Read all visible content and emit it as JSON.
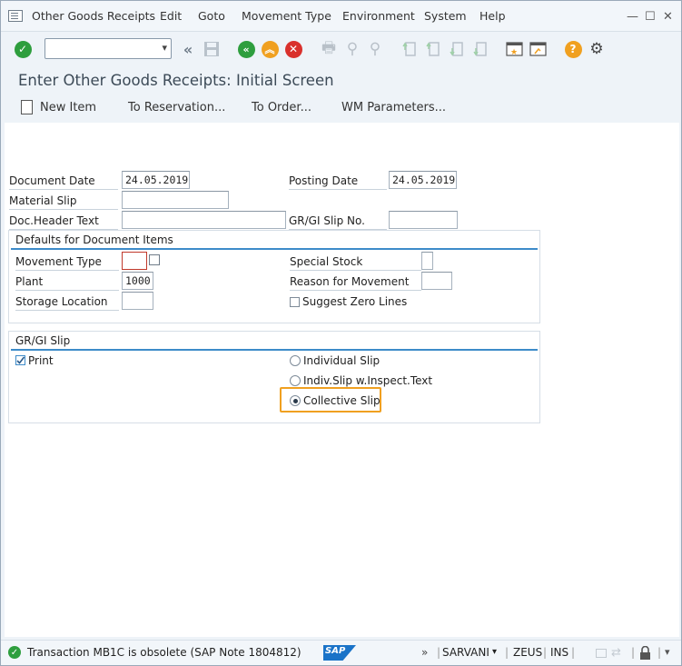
{
  "menu": {
    "items": [
      "Other Goods Receipts",
      "Edit",
      "Goto",
      "Movement Type",
      "Environment",
      "System",
      "Help"
    ],
    "window_buttons": [
      "—",
      "☐",
      "✕"
    ]
  },
  "toolbar": {
    "command_value": "",
    "icons": [
      "enter-icon",
      "back-double-icon",
      "save-icon",
      "back-icon",
      "exit-icon",
      "cancel-icon",
      "print-icon",
      "find-icon",
      "find-next-icon",
      "first-page-icon",
      "prev-page-icon",
      "next-page-icon",
      "last-page-icon",
      "new-session-icon",
      "shortcut-icon",
      "help-icon",
      "settings-icon"
    ]
  },
  "title": "Enter Other Goods Receipts: Initial Screen",
  "app_toolbar": {
    "new_item": "New Item",
    "to_reservation": "To Reservation...",
    "to_order": "To Order...",
    "wm_parameters": "WM Parameters..."
  },
  "header": {
    "document_date_label": "Document Date",
    "document_date_value": "24.05.2019",
    "posting_date_label": "Posting Date",
    "posting_date_value": "24.05.2019",
    "material_slip_label": "Material Slip",
    "material_slip_value": "",
    "doc_header_text_label": "Doc.Header Text",
    "doc_header_text_value": "",
    "gr_gi_slip_no_label": "GR/GI Slip No.",
    "gr_gi_slip_no_value": ""
  },
  "defaults": {
    "title": "Defaults for Document Items",
    "movement_type_label": "Movement Type",
    "movement_type_value": "",
    "special_stock_label": "Special Stock",
    "special_stock_value": "",
    "plant_label": "Plant",
    "plant_value": "1000",
    "reason_label": "Reason for Movement",
    "reason_value": "",
    "storage_location_label": "Storage Location",
    "storage_location_value": "",
    "suggest_zero_lines_label": "Suggest Zero Lines",
    "suggest_zero_lines_checked": false
  },
  "slip": {
    "title": "GR/GI Slip",
    "print_label": "Print",
    "print_checked": true,
    "individual_slip": "Individual Slip",
    "indiv_slip_inspect": "Indiv.Slip w.Inspect.Text",
    "collective_slip": "Collective Slip",
    "selected": "Collective Slip",
    "highlight_color": "#f0a020"
  },
  "status": {
    "message": "Transaction MB1C is obsolete (SAP Note 1804812)",
    "logo": "SAP",
    "forward": "»",
    "user": "SARVANI",
    "system": "ZEUS",
    "mode": "INS"
  }
}
